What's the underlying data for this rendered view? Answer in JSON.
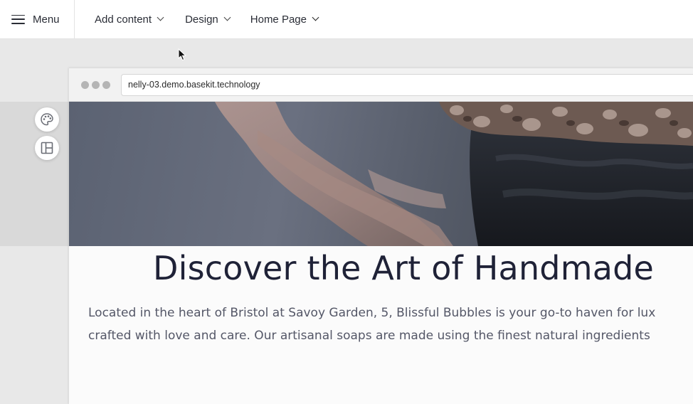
{
  "toolbar": {
    "menu_label": "Menu",
    "add_content_label": "Add content",
    "design_label": "Design",
    "page_label": "Home Page"
  },
  "browser": {
    "url": "nelly-03.demo.basekit.technology"
  },
  "sidebar": {
    "buttons": [
      {
        "icon": "palette-icon"
      },
      {
        "icon": "layout-icon"
      }
    ]
  },
  "content": {
    "headline": "Discover the Art of Handmade",
    "paragraph_line1": "Located in the heart of Bristol at Savoy Garden, 5, Blissful Bubbles is your go-to haven for lux",
    "paragraph_line2": "crafted with love and care. Our artisanal soaps are made using the finest natural ingredients"
  },
  "colors": {
    "headline": "#1f2237",
    "body_text": "#545767",
    "toolbar_bg": "#ffffff",
    "canvas_bg": "#e8e8e8"
  }
}
